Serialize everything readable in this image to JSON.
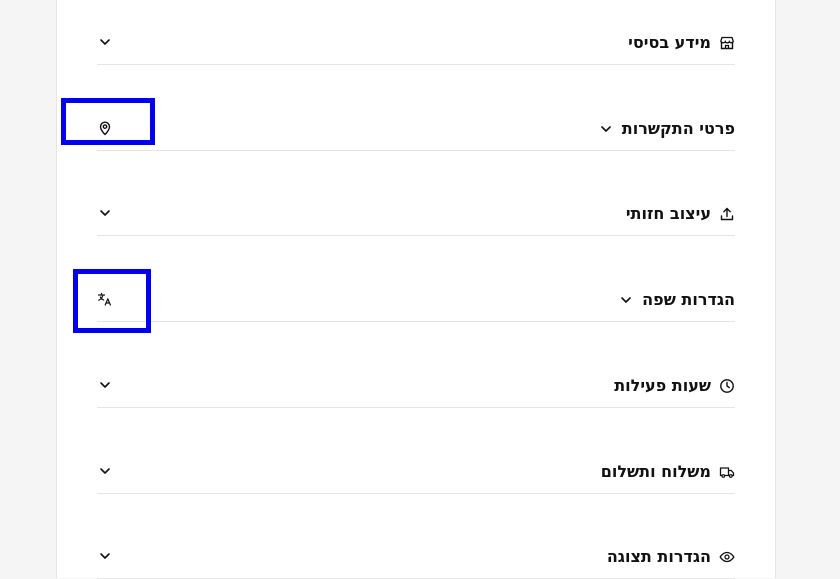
{
  "sections": [
    {
      "id": "basic-info",
      "label": "מידע בסיסי",
      "icon": "store-icon",
      "chevron": "left"
    },
    {
      "id": "contact-details",
      "label": "פרטי התקשרות",
      "icon": "map-pin-icon",
      "chevron": "inline"
    },
    {
      "id": "visual-design",
      "label": "עיצוב חזותי",
      "icon": "upload-icon",
      "chevron": "left"
    },
    {
      "id": "language-settings",
      "label": "הגדרות שפה",
      "icon": "translate-icon",
      "chevron": "inline"
    },
    {
      "id": "business-hours",
      "label": "שעות פעילות",
      "icon": "clock-icon",
      "chevron": "left"
    },
    {
      "id": "shipping-payment",
      "label": "משלוח ותשלום",
      "icon": "truck-icon",
      "chevron": "left"
    },
    {
      "id": "display-settings",
      "label": "הגדרות תצוגה",
      "icon": "eye-icon",
      "chevron": "left"
    }
  ],
  "colors": {
    "highlight": "#0000ee",
    "text": "#111111",
    "divider": "#e5e5e5",
    "background": "#f5f5f6"
  }
}
